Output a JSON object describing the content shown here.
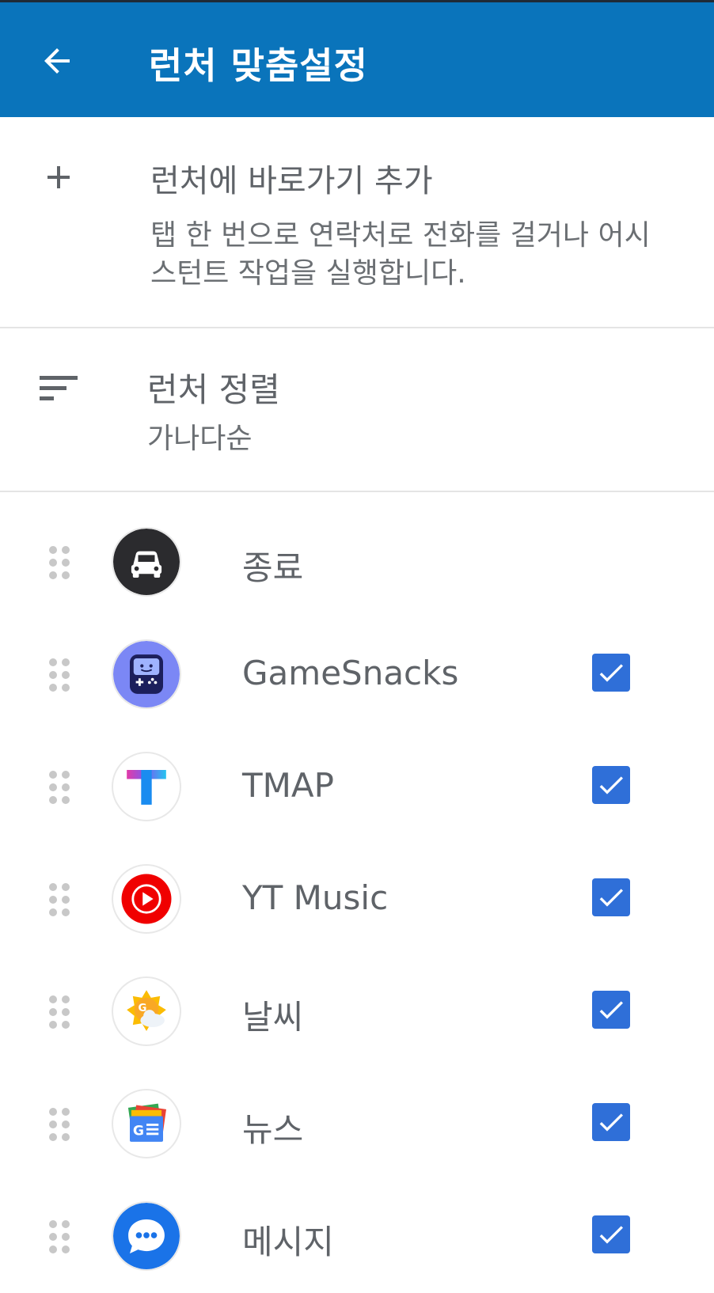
{
  "header": {
    "title": "런처 맞춤설정"
  },
  "add_shortcut": {
    "title": "런처에 바로가기 추가",
    "description": "탭 한 번으로 연락처로 전화를 걸거나 어시스턴트 작업을 실행합니다."
  },
  "sort": {
    "title": "런처 정렬",
    "value": "가나다순"
  },
  "apps": [
    {
      "label": "종료",
      "icon": "car-icon",
      "checked": null
    },
    {
      "label": "GameSnacks",
      "icon": "gamesnacks-icon",
      "checked": true
    },
    {
      "label": "TMAP",
      "icon": "tmap-icon",
      "checked": true
    },
    {
      "label": "YT Music",
      "icon": "yt-music-icon",
      "checked": true
    },
    {
      "label": "날씨",
      "icon": "weather-icon",
      "checked": true
    },
    {
      "label": "뉴스",
      "icon": "news-icon",
      "checked": true
    },
    {
      "label": "메시지",
      "icon": "messages-icon",
      "checked": true
    }
  ],
  "colors": {
    "appbar": "#0a74bb",
    "checkbox": "#2f6fd8",
    "text": "#5f6368"
  }
}
